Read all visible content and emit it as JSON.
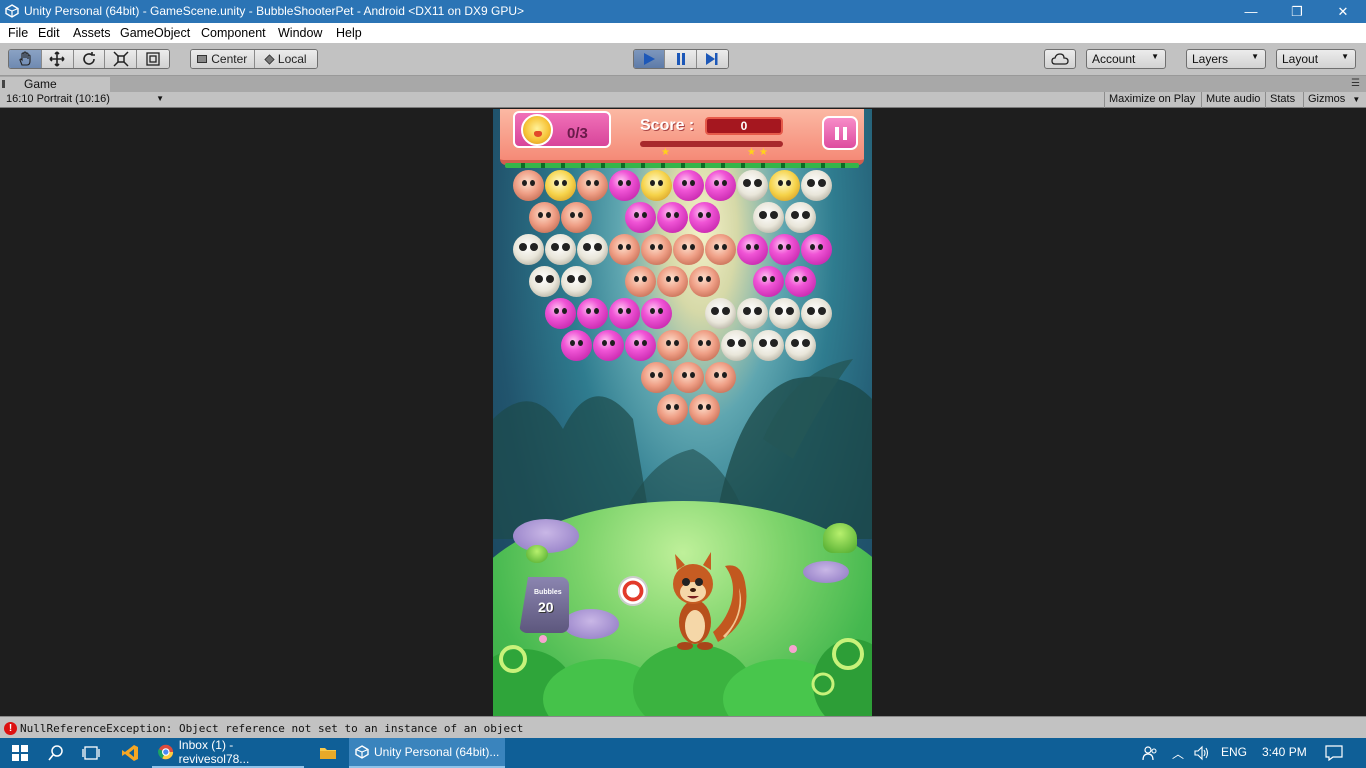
{
  "window": {
    "title": "Unity Personal (64bit) - GameScene.unity - BubbleShooterPet - Android <DX11 on DX9 GPU>",
    "minimize": "—",
    "restore": "❐",
    "close": "✕"
  },
  "menu": [
    "File",
    "Edit",
    "Assets",
    "GameObject",
    "Component",
    "Window",
    "Help"
  ],
  "toolbar": {
    "tools": [
      "hand-tool",
      "move-tool",
      "rotate-tool",
      "scale-tool",
      "rect-tool"
    ],
    "pivot_label": "Center",
    "space_label": "Local",
    "account_label": "Account",
    "layers_label": "Layers",
    "layout_label": "Layout",
    "play_state": "playing",
    "accent_color": "#4a6fa5"
  },
  "game_view": {
    "tab_label": "Game",
    "aspect": "16:10 Portrait (10:16)",
    "maximize_on_play": "Maximize on Play",
    "mute_audio": "Mute audio",
    "stats": "Stats",
    "gizmos": "Gizmos"
  },
  "game": {
    "target_count": "0/3",
    "score_label": "Score :",
    "score_value": "0",
    "bubbles_label": "Bubbles",
    "bubbles_left": "20",
    "bubble_colors": {
      "pink": "#e23fc9",
      "monkey": "#ef9f86",
      "panda": "#e9e6da",
      "bird": "#f6d34a"
    }
  },
  "console": {
    "message": "NullReferenceException: Object reference not set to an instance of an object",
    "error_color": "#d11111"
  },
  "taskbar": {
    "apps": [
      {
        "label": "Inbox (1) - revivesol78...",
        "icon": "chrome-icon"
      },
      {
        "label": "Unity Personal (64bit)...",
        "icon": "unity-icon"
      }
    ],
    "language": "ENG",
    "time": "3:40 PM"
  }
}
